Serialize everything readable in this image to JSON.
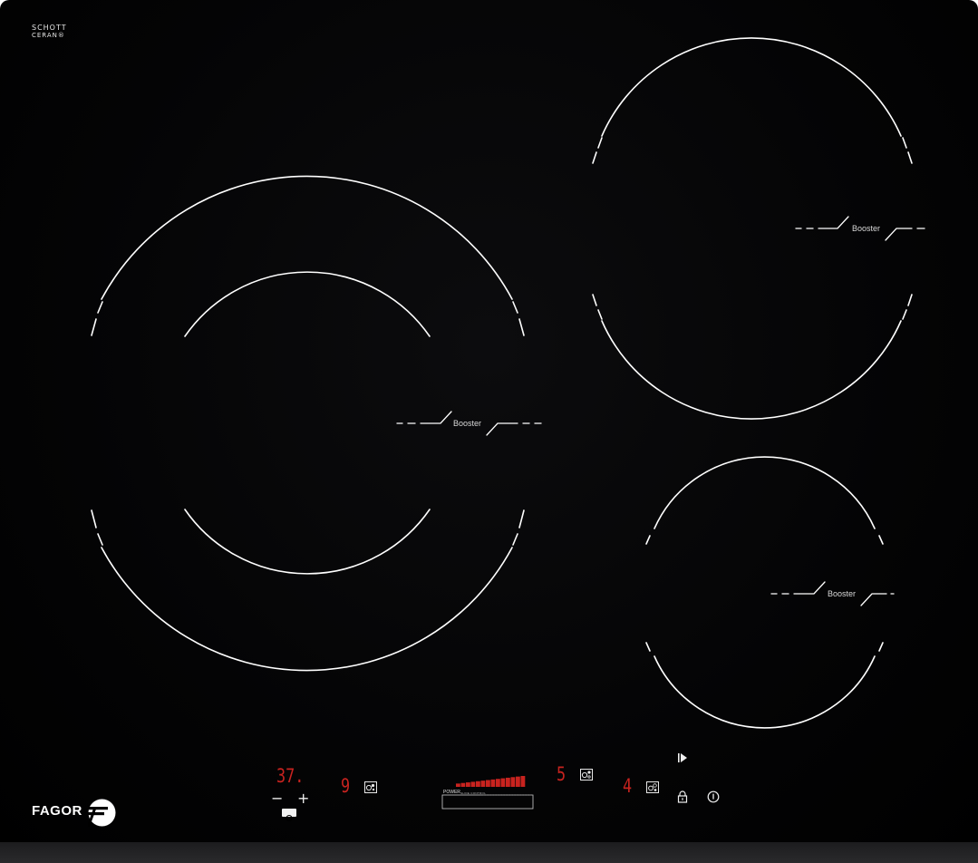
{
  "brand": {
    "glass_maker_line1": "SCHOTT",
    "glass_maker_line2": "CERAN®",
    "manufacturer": "FAGOR"
  },
  "zones": {
    "large_left_booster": "Booster",
    "top_right_booster": "Booster",
    "small_right_booster": "Booster"
  },
  "controls": {
    "left_zone_level": "37.",
    "timer_minus": "−",
    "timer_plus": "+",
    "zone_a_level": "9",
    "power_label": "POWER",
    "power_sub": "SLIDE CONTROL",
    "power_slider_level_fraction": 1.0,
    "zone_b_level": "5",
    "zone_c_level": "4"
  },
  "icons": {
    "timer": "clock-icon",
    "zone_a": "zone-selector-icon",
    "zone_b": "zone-selector-icon",
    "zone_c": "zone-selector-icon",
    "pause": "pause-play-icon",
    "lock": "lock-icon",
    "power": "power-icon",
    "logo": "fagor-logo-icon"
  },
  "colors": {
    "glass": "#050506",
    "display_red": "#c8231f",
    "markings": "#ffffff"
  }
}
